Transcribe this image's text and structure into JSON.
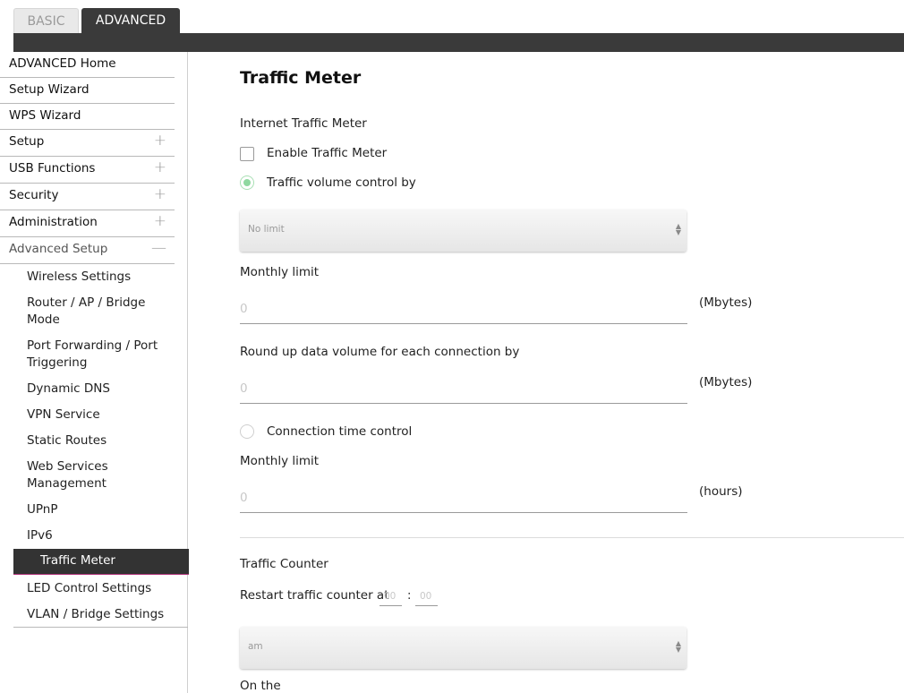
{
  "tabs": {
    "basic": "BASIC",
    "advanced": "ADVANCED"
  },
  "sidebar": {
    "top_items": [
      {
        "label": "ADVANCED Home",
        "toggle": ""
      },
      {
        "label": "Setup Wizard",
        "toggle": ""
      },
      {
        "label": "WPS Wizard",
        "toggle": ""
      },
      {
        "label": "Setup",
        "toggle": "+"
      },
      {
        "label": "USB Functions",
        "toggle": "+"
      },
      {
        "label": "Security",
        "toggle": "+"
      },
      {
        "label": "Administration",
        "toggle": "+"
      },
      {
        "label": "Advanced Setup",
        "toggle": "—"
      }
    ],
    "sub_items": [
      "Wireless Settings",
      "Router / AP / Bridge Mode",
      "Port Forwarding / Port Triggering",
      "Dynamic DNS",
      "VPN Service",
      "Static Routes",
      "Web Services Management",
      "UPnP",
      "IPv6",
      "Traffic Meter",
      "LED Control Settings",
      "VLAN / Bridge Settings"
    ],
    "active_item": "Traffic Meter"
  },
  "main": {
    "title": "Traffic Meter",
    "internet_traffic_meter_label": "Internet Traffic Meter",
    "enable_label": "Enable Traffic Meter",
    "enable_checked": false,
    "volume_control_label": "Traffic volume control by",
    "volume_control_selected": true,
    "volume_select_value": "No limit",
    "monthly_limit_label": "Monthly limit",
    "monthly_limit_value": "0",
    "mbytes_unit": "(Mbytes)",
    "round_up_label": "Round up data volume for each connection by",
    "round_up_value": "0",
    "connection_time_label": "Connection time control",
    "connection_time_selected": false,
    "monthly_limit_hours_label": "Monthly limit",
    "monthly_limit_hours_value": "0",
    "hours_unit": "(hours)",
    "traffic_counter_label": "Traffic Counter",
    "restart_label": "Restart traffic counter at",
    "restart_hour": "00",
    "restart_separator": ":",
    "restart_minute": "00",
    "ampm_select_value": "am",
    "on_the_label": "On the"
  },
  "colors": {
    "tab_active_bg": "#3a3a3a",
    "sidebar_active_bg": "#333333",
    "sidebar_active_underline": "#b0357a",
    "radio_selected": "#8fd8a0"
  }
}
